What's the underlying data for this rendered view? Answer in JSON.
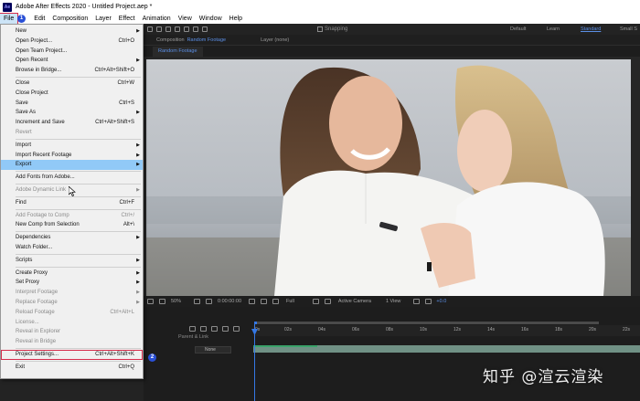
{
  "window": {
    "app_logo": "Ae",
    "title": "Adobe After Effects 2020 - Untitled Project.aep *"
  },
  "menubar": {
    "items": [
      "File",
      "Edit",
      "Composition",
      "Layer",
      "Effect",
      "Animation",
      "View",
      "Window",
      "Help"
    ]
  },
  "markers": {
    "one": "1",
    "two": "2"
  },
  "file_menu": {
    "new": "New",
    "open_project": "Open Project...",
    "open_project_sc": "Ctrl+O",
    "open_team_project": "Open Team Project...",
    "open_recent": "Open Recent",
    "browse_bridge": "Browse in Bridge...",
    "browse_bridge_sc": "Ctrl+Alt+Shift+O",
    "close": "Close",
    "close_sc": "Ctrl+W",
    "close_project": "Close Project",
    "save": "Save",
    "save_sc": "Ctrl+S",
    "save_as": "Save As",
    "increment_save": "Increment and Save",
    "increment_save_sc": "Ctrl+Alt+Shift+S",
    "revert": "Revert",
    "import": "Import",
    "import_recent": "Import Recent Footage",
    "export": "Export",
    "add_fonts": "Add Fonts from Adobe...",
    "dynamic_link": "Adobe Dynamic Link",
    "find": "Find",
    "find_sc": "Ctrl+F",
    "add_footage": "Add Footage to Comp",
    "add_footage_sc": "Ctrl+/",
    "new_comp_sel": "New Comp from Selection",
    "new_comp_sel_sc": "Alt+\\",
    "dependencies": "Dependencies",
    "watch_folder": "Watch Folder...",
    "scripts": "Scripts",
    "create_proxy": "Create Proxy",
    "set_proxy": "Set Proxy",
    "interpret_footage": "Interpret Footage",
    "replace_footage": "Replace Footage",
    "reload_footage": "Reload Footage",
    "reload_footage_sc": "Ctrl+Alt+L",
    "license": "License...",
    "reveal_explorer": "Reveal in Explorer",
    "reveal_bridge": "Reveal in Bridge",
    "project_settings": "Project Settings...",
    "project_settings_sc": "Ctrl+Alt+Shift+K",
    "exit": "Exit",
    "exit_sc": "Ctrl+Q"
  },
  "toolbar": {
    "snapping": "Snapping",
    "workspaces": [
      "Default",
      "Learn",
      "Standard",
      "Small S"
    ]
  },
  "panel": {
    "composition_label": "Composition",
    "composition_name": "Random Footage",
    "layer_label": "Layer (none)",
    "comp_tab": "Random Footage"
  },
  "viewer_bar": {
    "zoom": "50%",
    "timecode": "0:00:00:00",
    "resolution": "Full",
    "camera": "Active Camera",
    "views": "1 View",
    "exposure": "+0.0"
  },
  "timeline": {
    "ticks": [
      "0s",
      "02s",
      "04s",
      "06s",
      "08s",
      "10s",
      "12s",
      "14s",
      "16s",
      "18s",
      "20s",
      "22s"
    ],
    "parent_link": "Parent & Link",
    "layer_mode": "None"
  },
  "watermark": "知乎 @渲云渲染"
}
